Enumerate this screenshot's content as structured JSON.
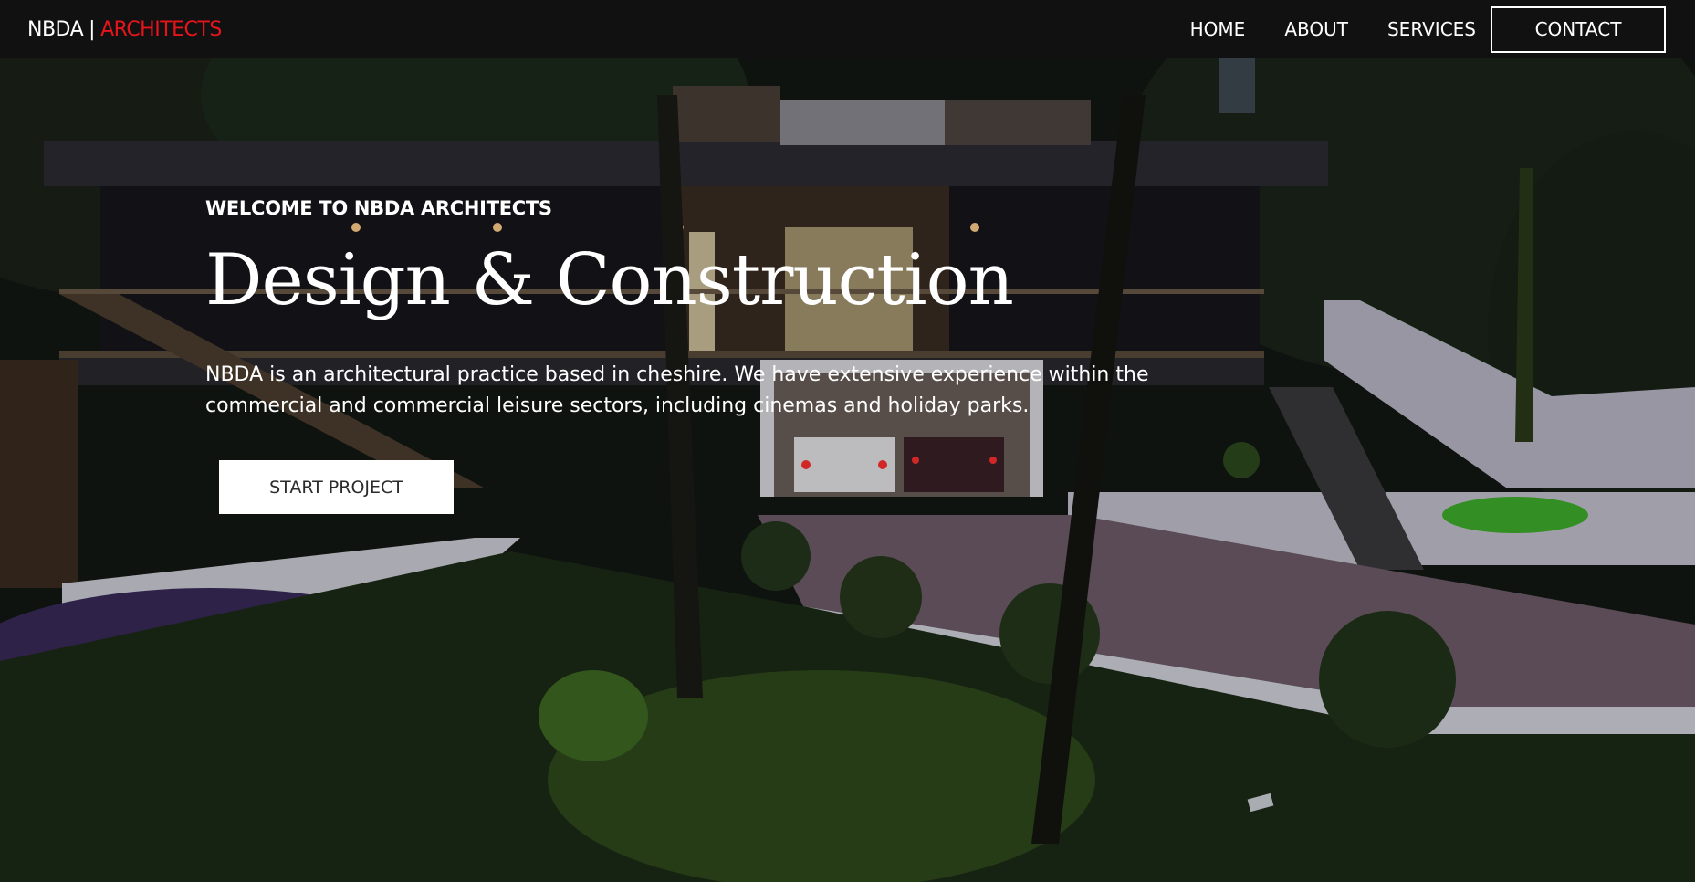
{
  "nav": {
    "brand_primary": "NBDA",
    "brand_separator": "|",
    "brand_secondary": "ARCHITECTS",
    "links": [
      {
        "label": "HOME"
      },
      {
        "label": "ABOUT"
      },
      {
        "label": "SERVICES"
      }
    ],
    "contact_label": "CONTACT"
  },
  "hero": {
    "eyebrow": "WELCOME TO NBDA ARCHITECTS",
    "headline": "Design & Construction",
    "description": "NBDA is an architectural practice based in cheshire. We have extensive experience within the commercial and commercial leisure sectors, including cinemas and holiday parks.",
    "cta_label": "START PROJECT",
    "background": "night-house-photo"
  },
  "colors": {
    "nav_bg": "#111111",
    "brand_accent": "#e8141b",
    "text": "#ffffff",
    "cta_bg": "#ffffff",
    "cta_text": "#2b2b2b"
  }
}
